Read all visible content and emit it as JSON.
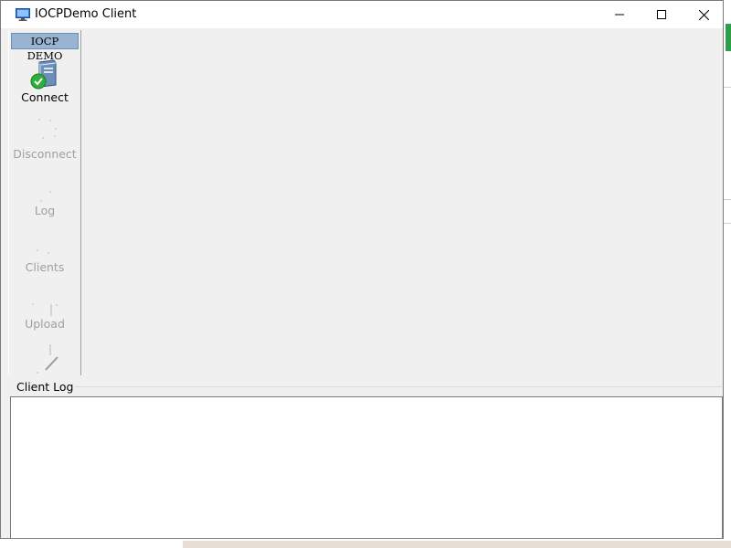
{
  "window": {
    "title": "IOCPDemo Client",
    "icons": {
      "app": "monitor-icon",
      "minimize": "minimize-icon",
      "maximize": "maximize-icon",
      "close": "close-icon"
    }
  },
  "toolbar": {
    "header": "IOCP DEMO",
    "items": [
      {
        "label": "Connect",
        "enabled": true,
        "icon": "server-connect-icon"
      },
      {
        "label": "Disconnect",
        "enabled": false,
        "icon": "disconnect-icon"
      },
      {
        "label": "Log",
        "enabled": false,
        "icon": "log-icon"
      },
      {
        "label": "Clients",
        "enabled": false,
        "icon": "clients-icon"
      },
      {
        "label": "Upload",
        "enabled": false,
        "icon": "upload-icon"
      },
      {
        "label": "",
        "enabled": false,
        "icon": "download-icon"
      }
    ]
  },
  "log": {
    "label": "Client Log",
    "content": ""
  },
  "colors": {
    "header_bg": "#99b4d1",
    "disabled_text": "#a0a0a0",
    "connect_green": "#2fae3a"
  }
}
